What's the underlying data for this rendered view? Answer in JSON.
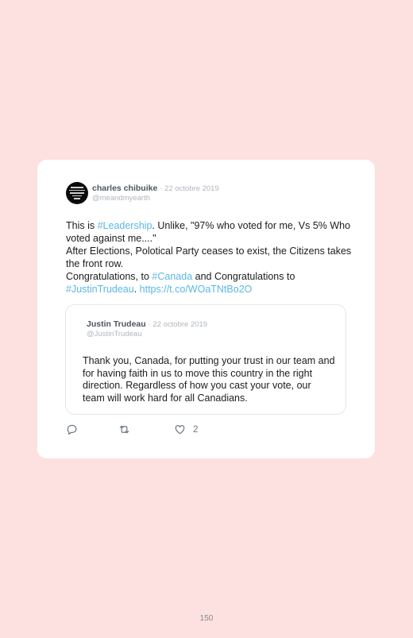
{
  "tweet": {
    "author_name": "charles chibuike",
    "date": "22 octobre 2019",
    "handle": "@meandmyearth",
    "text": {
      "s1": "This is ",
      "h1": "#Leadership",
      "s2": ". Unlike, \"97% who voted for me, Vs 5% Who voted against me....\"",
      "line2": "After Elections, Polotical Party ceases to exist, the Citizens takes the front row.",
      "s3": "Congratulations, to ",
      "h2": "#Canada",
      "s4": " and Congratulations to ",
      "h3": "#JustinTrudeau",
      "s5": ". ",
      "url": "https://t.co/WOaTNtBo2O"
    }
  },
  "quoted_tweet": {
    "author_name": "Justin Trudeau",
    "date": "22 octobre 2019",
    "handle": "@JustinTrudeau",
    "text": "Thank you, Canada, for putting your trust in our team and for having faith in us to move this country in the right direction. Regardless of how you cast your vote, our team will work hard for all Canadians."
  },
  "actions": {
    "reply_icon": "speech-bubble-icon",
    "retweet_icon": "retweet-icon",
    "like_icon": "heart-icon",
    "like_count": "2"
  },
  "page_number": "150",
  "colors": {
    "background": "#fde0e0",
    "card": "#ffffff",
    "link": "#5bb7e6",
    "muted": "#b0b6bd"
  }
}
